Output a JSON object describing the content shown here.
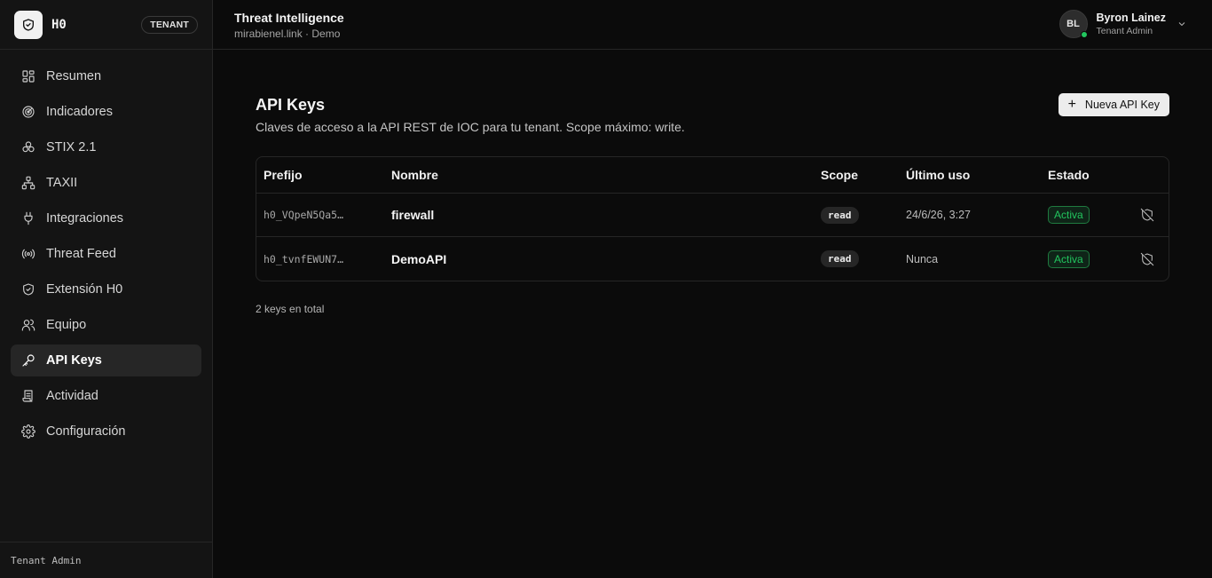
{
  "brand": {
    "name": "H0",
    "badge": "TENANT"
  },
  "sidebar": {
    "items": [
      {
        "label": "Resumen",
        "icon": "dashboard-icon"
      },
      {
        "label": "Indicadores",
        "icon": "radar-icon"
      },
      {
        "label": "STIX 2.1",
        "icon": "boxes-icon"
      },
      {
        "label": "TAXII",
        "icon": "network-icon"
      },
      {
        "label": "Integraciones",
        "icon": "plug-icon"
      },
      {
        "label": "Threat Feed",
        "icon": "broadcast-icon"
      },
      {
        "label": "Extensión H0",
        "icon": "shield-check-icon"
      },
      {
        "label": "Equipo",
        "icon": "users-icon"
      },
      {
        "label": "API Keys",
        "icon": "key-icon",
        "active": true
      },
      {
        "label": "Actividad",
        "icon": "scroll-icon"
      },
      {
        "label": "Configuración",
        "icon": "gear-icon"
      }
    ],
    "footer": "Tenant Admin"
  },
  "header": {
    "title": "Threat Intelligence",
    "subtitle": "mirabienel.link · Demo",
    "user": {
      "initials": "BL",
      "name": "Byron Lainez",
      "role": "Tenant Admin",
      "status": "online"
    }
  },
  "page": {
    "title": "API Keys",
    "description": "Claves de acceso a la API REST de IOC para tu tenant. Scope máximo: write.",
    "new_button": "Nueva API Key"
  },
  "table": {
    "headers": {
      "prefix": "Prefijo",
      "name": "Nombre",
      "scope": "Scope",
      "last_used": "Último uso",
      "status": "Estado"
    },
    "rows": [
      {
        "prefix": "h0_VQpeN5Qa5…",
        "name": "firewall",
        "scope": "read",
        "last_used": "24/6/26, 3:27",
        "status": "Activa"
      },
      {
        "prefix": "h0_tvnfEWUN7…",
        "name": "DemoAPI",
        "scope": "read",
        "last_used": "Nunca",
        "status": "Activa"
      }
    ]
  },
  "total": "2 keys en total",
  "colors": {
    "accent": "#22c55e",
    "background": "#0b0b0b",
    "sidebar": "#141414"
  }
}
